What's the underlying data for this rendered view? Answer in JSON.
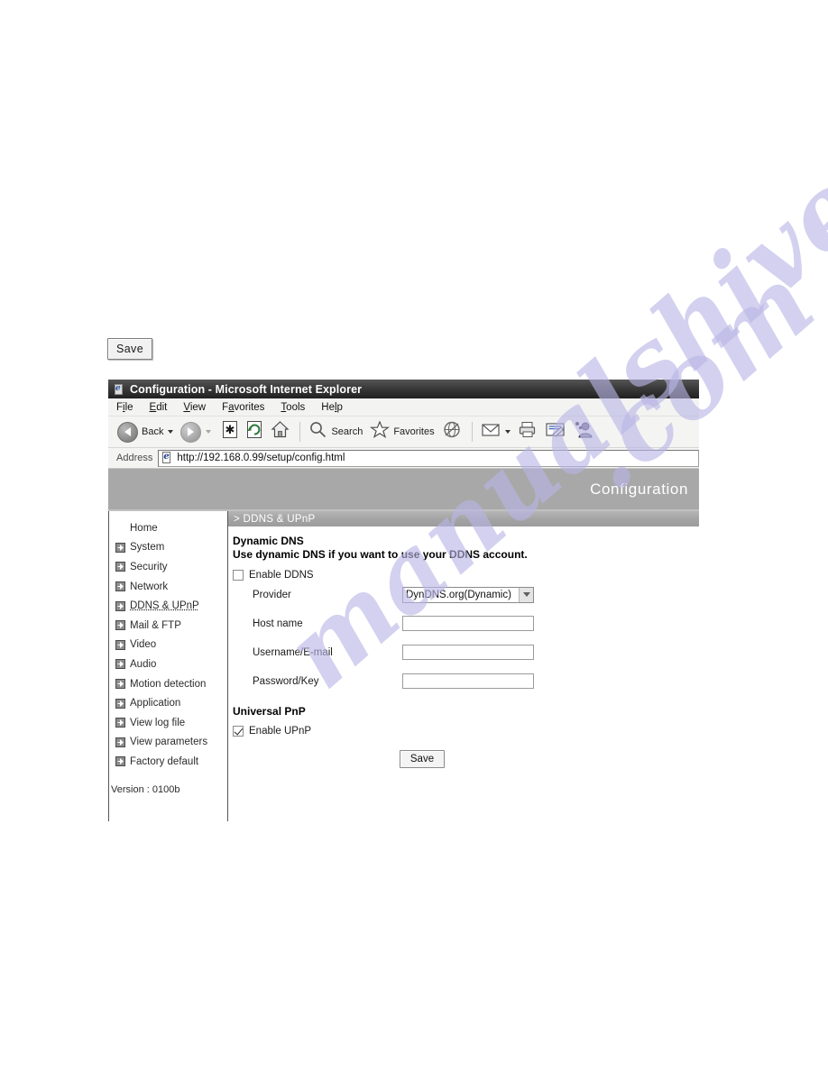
{
  "page": {
    "standalone_save_label": "Save"
  },
  "browser": {
    "window_title": "Configuration - Microsoft Internet Explorer",
    "menu": [
      {
        "pre": "F",
        "acc": "i",
        "post": "le"
      },
      {
        "pre": "",
        "acc": "E",
        "post": "dit"
      },
      {
        "pre": "",
        "acc": "V",
        "post": "iew"
      },
      {
        "pre": "F",
        "acc": "a",
        "post": "vorites"
      },
      {
        "pre": "",
        "acc": "T",
        "post": "ools"
      },
      {
        "pre": "He",
        "acc": "l",
        "post": "p"
      }
    ],
    "toolbar": {
      "back_label": "Back",
      "search_label": "Search",
      "favorites_label": "Favorites"
    },
    "address": {
      "label": "Address",
      "url": "http://192.168.0.99/setup/config.html"
    }
  },
  "webpage": {
    "banner_title": "Configuration",
    "breadcrumb": "> DDNS & UPnP",
    "sidebar": {
      "items": [
        {
          "label": "Home",
          "has_arrow": false,
          "active": false
        },
        {
          "label": "System",
          "has_arrow": true,
          "active": false
        },
        {
          "label": "Security",
          "has_arrow": true,
          "active": false
        },
        {
          "label": "Network",
          "has_arrow": true,
          "active": false
        },
        {
          "label": "DDNS & UPnP",
          "has_arrow": true,
          "active": true
        },
        {
          "label": "Mail & FTP",
          "has_arrow": true,
          "active": false
        },
        {
          "label": "Video",
          "has_arrow": true,
          "active": false
        },
        {
          "label": "Audio",
          "has_arrow": true,
          "active": false
        },
        {
          "label": "Motion detection",
          "has_arrow": true,
          "active": false
        },
        {
          "label": "Application",
          "has_arrow": true,
          "active": false
        },
        {
          "label": "View log file",
          "has_arrow": true,
          "active": false
        },
        {
          "label": "View parameters",
          "has_arrow": true,
          "active": false
        },
        {
          "label": "Factory default",
          "has_arrow": true,
          "active": false
        }
      ],
      "version": "Version : 0100b"
    },
    "ddns": {
      "title": "Dynamic DNS",
      "description": "Use dynamic DNS if you want to use your DDNS account.",
      "enable_label": "Enable DDNS",
      "enable_checked": false,
      "fields": [
        {
          "label": "Provider",
          "type": "select",
          "value": "DynDNS.org(Dynamic)"
        },
        {
          "label": "Host name",
          "type": "text",
          "value": ""
        },
        {
          "label": "Username/E-mail",
          "type": "text",
          "value": ""
        },
        {
          "label": "Password/Key",
          "type": "text",
          "value": ""
        }
      ]
    },
    "upnp": {
      "title": "Universal PnP",
      "enable_label": "Enable UPnP",
      "enable_checked": true
    },
    "save_label": "Save"
  },
  "watermark": {
    "line_a": "manualshive",
    "line_b": ".com"
  }
}
